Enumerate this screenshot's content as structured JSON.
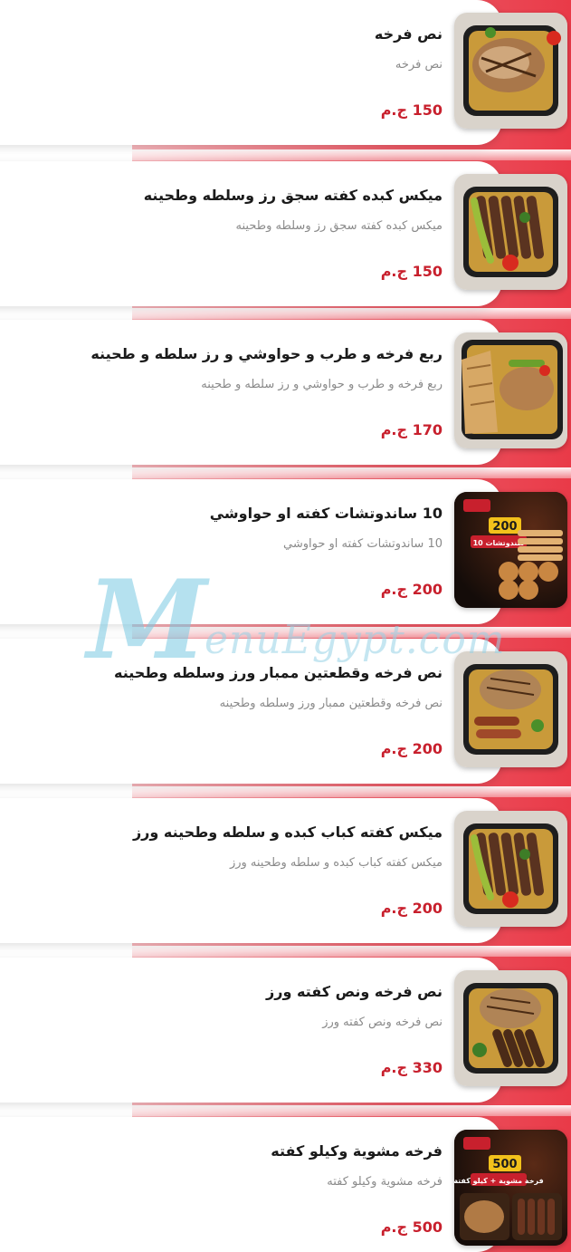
{
  "colors": {
    "accent_red": "#c8202d",
    "background_gradient_start": "#f6b5bb",
    "background_gradient_end": "#e93a48",
    "card_background": "#ffffff",
    "watermark": "#78c8e1"
  },
  "watermark": {
    "letter": "M",
    "text": "enuEgypt.com"
  },
  "menu_items": [
    {
      "name": "نص فرخه",
      "description": "نص فرخه",
      "price": "150 ج.م",
      "image": "grilled-half-chicken-photo"
    },
    {
      "name": "ميكس كبده كفته سجق رز وسلطه وطحينه",
      "description": "ميكس كبده كفته سجق رز وسلطه وطحينه",
      "price": "150 ج.م",
      "image": "mixed-grill-kofta-sausage-photo"
    },
    {
      "name": "ربع فرخه و طرب و حواوشي و رز سلطه و طحينه",
      "description": "ربع فرخه و طرب و حواوشي و رز سلطه و طحينه",
      "price": "170 ج.م",
      "image": "quarter-chicken-hawawshi-photo"
    },
    {
      "name": "10 ساندوتشات كفته او حواوشي",
      "description": "10 ساندوتشات كفته او حواوشي",
      "price": "200 ج.م",
      "image": "sandwiches-offer-poster",
      "poster_text": [
        "200",
        "10 سندوتشات"
      ]
    },
    {
      "name": "نص فرخه وقطعتين ممبار  ورز وسلطه وطحينه",
      "description": "نص فرخه وقطعتين ممبار  ورز وسلطه وطحينه",
      "price": "200 ج.م",
      "image": "chicken-mombar-photo"
    },
    {
      "name": "ميكس كفته كباب كبده و سلطه وطحينه ورز",
      "description": "ميكس كفته كباب كبده و سلطه وطحينه ورز",
      "price": "200 ج.م",
      "image": "kofta-kebab-mix-photo"
    },
    {
      "name": "نص فرخه ونص كفته ورز",
      "description": "نص فرخه ونص كفته ورز",
      "price": "330 ج.م",
      "image": "chicken-kofta-platter-photo"
    },
    {
      "name": "فرخه مشوية وكيلو كفته",
      "description": "فرخه مشوية وكيلو كفته",
      "price": "500 ج.م",
      "image": "chicken-kilo-kofta-poster",
      "poster_text": [
        "500",
        "فرخة مشوية + كيلو كفتة"
      ]
    }
  ]
}
